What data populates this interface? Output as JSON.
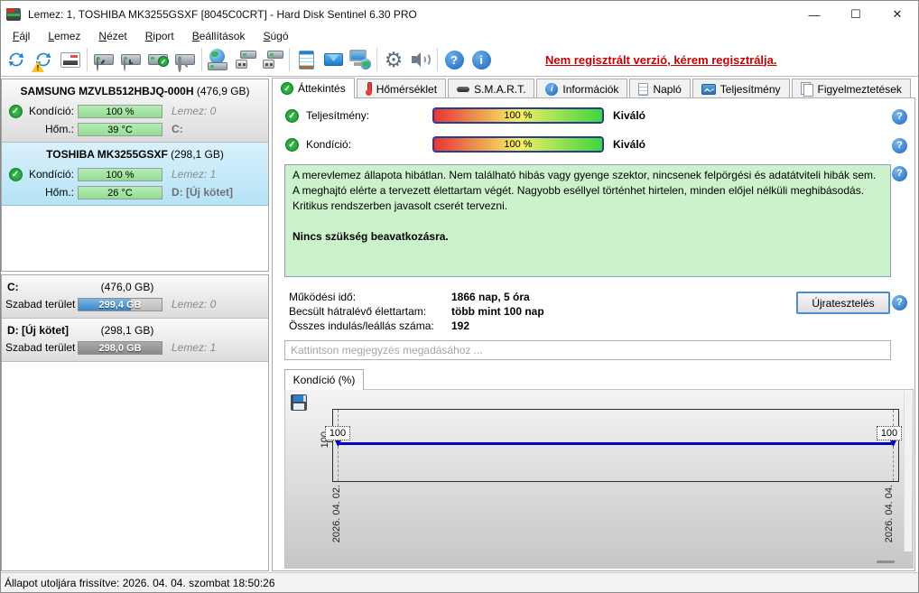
{
  "window": {
    "title": "Lemez: 1, TOSHIBA MK3255GSXF [8045C0CRT]  -  Hard Disk Sentinel 6.30 PRO",
    "controls": {
      "minimize": "—",
      "maximize": "☐",
      "close": "✕"
    }
  },
  "menu": {
    "items": [
      {
        "label": "Fájl"
      },
      {
        "label": "Lemez"
      },
      {
        "label": "Nézet"
      },
      {
        "label": "Riport"
      },
      {
        "label": "Beállítások"
      },
      {
        "label": "Súgó"
      }
    ]
  },
  "toolbar": {
    "register_text": "Nem regisztrált verzió, kérem regisztrálja.",
    "icons": [
      "refresh-icon",
      "refresh-warning-icon",
      "report-icon",
      "disk-surface-test-icon",
      "disk-scheduler-icon",
      "disk-health-icon",
      "disk-analyze-icon",
      "network-disk-icon",
      "disk-connect-icon",
      "disk-disconnect-icon",
      "log-notepad-icon",
      "email-icon",
      "remote-computer-icon",
      "settings-gear-icon",
      "sound-icon",
      "help-icon",
      "info-icon"
    ]
  },
  "sidebar": {
    "disks": [
      {
        "name": "SAMSUNG MZVLB512HBJQ-000H",
        "size": "(476,9 GB)",
        "condition_label": "Kondíció:",
        "condition_value": "100 %",
        "disk_label": "Lemez: 0",
        "temp_label": "Hőm.:",
        "temp_value": "39 °C",
        "volume": "C:"
      },
      {
        "name": "TOSHIBA MK3255GSXF",
        "size": "(298,1 GB)",
        "condition_label": "Kondíció:",
        "condition_value": "100 %",
        "disk_label": "Lemez: 1",
        "temp_label": "Hőm.:",
        "temp_value": "26 °C",
        "volume": "D: [Új kötet]"
      }
    ],
    "partitions": [
      {
        "name": "C:",
        "size": "(476,0 GB)",
        "free_label": "Szabad terület",
        "free_value": "299,4 GB",
        "disk_label": "Lemez: 0",
        "free_percent": 63,
        "fill_color": "#3c86c8"
      },
      {
        "name": "D: [Új kötet]",
        "size": "(298,1 GB)",
        "free_label": "Szabad terület",
        "free_value": "298,0 GB",
        "disk_label": "Lemez: 1",
        "free_percent": 100,
        "fill_color": "#8a8a8a"
      }
    ]
  },
  "tabs": [
    {
      "label": "Áttekintés",
      "icon": "check-icon",
      "active": true
    },
    {
      "label": "Hőmérséklet",
      "icon": "thermometer-icon",
      "active": false
    },
    {
      "label": "S.M.A.R.T.",
      "icon": "disk-dash-icon",
      "active": false
    },
    {
      "label": "Információk",
      "icon": "info-icon",
      "active": false
    },
    {
      "label": "Napló",
      "icon": "page-icon",
      "active": false
    },
    {
      "label": "Teljesítmény",
      "icon": "chart-icon",
      "active": false
    },
    {
      "label": "Figyelmeztetések",
      "icon": "pages-icon",
      "active": false
    }
  ],
  "overview": {
    "performance_label": "Teljesítmény:",
    "performance_value": "100 %",
    "performance_rating": "Kiváló",
    "condition_label": "Kondíció:",
    "condition_value": "100 %",
    "condition_rating": "Kiváló",
    "status_paragraph": "A merevlemez állapota hibátlan. Nem található hibás vagy gyenge szektor, nincsenek felpörgési és adatátviteli hibák sem. A meghajtó elérte a tervezett élettartam végét. Nagyobb eséllyel történhet hirtelen, minden előjel nélküli meghibásodás. Kritikus rendszerben javasolt cserét tervezni.",
    "status_action": "Nincs szükség beavatkozásra.",
    "stats": [
      {
        "label": "Működési idő:",
        "value": "1866 nap, 5 óra"
      },
      {
        "label": "Becsült hátralévő élettartam:",
        "value": "több mint 100 nap"
      },
      {
        "label": "Összes indulás/leállás száma:",
        "value": "192"
      }
    ],
    "retest_button": "Újratesztelés",
    "comment_placeholder": "Kattintson megjegyzés megadásához ..."
  },
  "chart_data": {
    "type": "line",
    "title": "Kondíció  (%)",
    "x": [
      "2026. 04. 02.",
      "2026. 04. 04."
    ],
    "values": [
      100,
      100
    ],
    "point_labels": [
      "100",
      "100"
    ],
    "ytick": "100",
    "ylim": [
      0,
      100
    ],
    "line_color": "#0000bb",
    "legend": "none"
  },
  "statusbar": {
    "text": "Állapot utoljára frissítve: 2026. 04. 04. szombat 18:50:26"
  },
  "colors": {
    "register_red": "#cc0000",
    "health_green": "#2ca32c",
    "selected_card_blue": "#c5e8f7",
    "status_box_green": "#ccf2cb"
  }
}
